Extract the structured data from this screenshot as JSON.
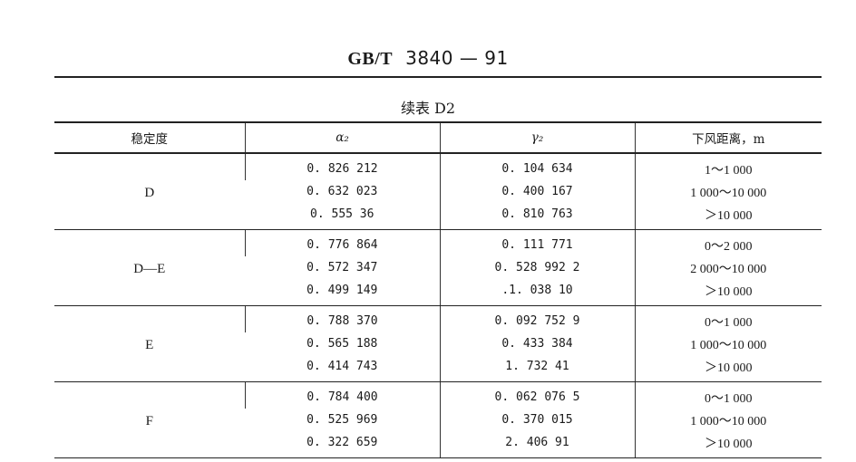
{
  "header": {
    "standard": "GB/T",
    "number": "3840 — 91"
  },
  "caption": "续表 D2",
  "table": {
    "headers": [
      "稳定度",
      "α₂",
      "γ₂",
      "下风距离，m"
    ],
    "groups": [
      {
        "stability": "D",
        "rows": [
          [
            "0. 826 212",
            "0. 104 634",
            "1～1 000"
          ],
          [
            "0. 632 023",
            "0. 400 167",
            "1 000～10 000"
          ],
          [
            "0. 555 36",
            "0. 810 763",
            "＞10 000"
          ]
        ]
      },
      {
        "stability": "D—E",
        "rows": [
          [
            "0. 776 864",
            "0. 111 771",
            "0～2 000"
          ],
          [
            "0. 572 347",
            "0. 528 992 2",
            "2 000～10 000"
          ],
          [
            "0. 499 149",
            ".1. 038 10",
            "＞10 000"
          ]
        ]
      },
      {
        "stability": "E",
        "rows": [
          [
            "0. 788 370",
            "0. 092 752 9",
            "0～1 000"
          ],
          [
            "0. 565 188",
            "0. 433 384",
            "1 000～10 000"
          ],
          [
            "0. 414 743",
            "1. 732 41",
            "＞10 000"
          ]
        ]
      },
      {
        "stability": "F",
        "rows": [
          [
            "0. 784 400",
            "0. 062 076 5",
            "0～1 000"
          ],
          [
            "0. 525 969",
            "0. 370 015",
            "1 000～10 000"
          ],
          [
            "0. 322 659",
            "2. 406 91",
            "＞10 000"
          ]
        ]
      }
    ]
  }
}
